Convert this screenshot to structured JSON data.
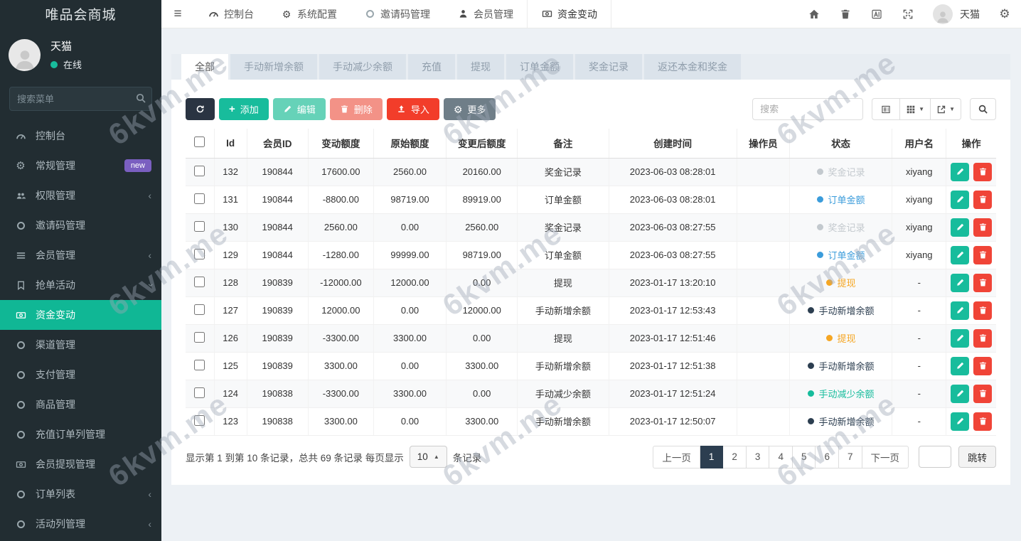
{
  "watermark": {
    "text": "6kvm.me"
  },
  "sidebar": {
    "title": "唯品会商城",
    "user": {
      "name": "天猫",
      "status": "在线"
    },
    "search_placeholder": "搜索菜单",
    "items": [
      {
        "label": "控制台",
        "icon": "dashboard-icon"
      },
      {
        "label": "常规管理",
        "icon": "gears-icon",
        "badge": "new"
      },
      {
        "label": "权限管理",
        "icon": "users-icon",
        "chevron": "left"
      },
      {
        "label": "邀请码管理",
        "icon": "circle-icon"
      },
      {
        "label": "会员管理",
        "icon": "list-icon",
        "chevron": "left"
      },
      {
        "label": "抢单活动",
        "icon": "bookmark-icon",
        "chevron": "down"
      },
      {
        "label": "资金变动",
        "icon": "money-icon",
        "active": true
      },
      {
        "label": "渠道管理",
        "icon": "circle-icon"
      },
      {
        "label": "支付管理",
        "icon": "circle-icon"
      },
      {
        "label": "商品管理",
        "icon": "circle-icon"
      },
      {
        "label": "充值订单列管理",
        "icon": "circle-icon"
      },
      {
        "label": "会员提现管理",
        "icon": "money-icon"
      },
      {
        "label": "订单列表",
        "icon": "circle-icon",
        "chevron": "left"
      },
      {
        "label": "活动列管理",
        "icon": "circle-icon",
        "chevron": "left"
      }
    ]
  },
  "navbar": {
    "items": [
      {
        "label": "控制台",
        "icon": "dashboard-icon"
      },
      {
        "label": "系统配置",
        "icon": "gear-icon"
      },
      {
        "label": "邀请码管理",
        "icon": "circle-icon"
      },
      {
        "label": "会员管理",
        "icon": "person-icon"
      },
      {
        "label": "资金变动",
        "icon": "money-icon",
        "active": true
      }
    ],
    "right_icons": [
      "home-icon",
      "trash-icon",
      "translate-icon",
      "fullscreen-icon"
    ],
    "user_name": "天猫"
  },
  "tabs": [
    "全部",
    "手动新增余额",
    "手动减少余额",
    "充值",
    "提现",
    "订单金额",
    "奖金记录",
    "返还本金和奖金"
  ],
  "active_tab": "全部",
  "toolbar": {
    "add_label": "添加",
    "edit_label": "编辑",
    "delete_label": "删除",
    "import_label": "导入",
    "more_label": "更多",
    "search_placeholder": "搜索"
  },
  "table": {
    "columns": [
      "Id",
      "会员ID",
      "变动额度",
      "原始额度",
      "变更后额度",
      "备注",
      "创建时间",
      "操作员",
      "状态",
      "用户名",
      "操作"
    ],
    "status_colors": {
      "gray": "#c3c9ce",
      "blue": "#3b9cdb",
      "orange": "#f5a623",
      "dark": "#2c3e50",
      "green": "#16bc9c"
    },
    "rows": [
      {
        "id": "132",
        "member_id": "190844",
        "change": "17600.00",
        "original": "2560.00",
        "after": "20160.00",
        "remark": "奖金记录",
        "created": "2023-06-03 08:28:01",
        "operator": "",
        "status": {
          "label": "奖金记录",
          "color": "gray"
        },
        "username": "xiyang"
      },
      {
        "id": "131",
        "member_id": "190844",
        "change": "-8800.00",
        "original": "98719.00",
        "after": "89919.00",
        "remark": "订单金额",
        "created": "2023-06-03 08:28:01",
        "operator": "",
        "status": {
          "label": "订单金额",
          "color": "blue"
        },
        "username": "xiyang"
      },
      {
        "id": "130",
        "member_id": "190844",
        "change": "2560.00",
        "original": "0.00",
        "after": "2560.00",
        "remark": "奖金记录",
        "created": "2023-06-03 08:27:55",
        "operator": "",
        "status": {
          "label": "奖金记录",
          "color": "gray"
        },
        "username": "xiyang"
      },
      {
        "id": "129",
        "member_id": "190844",
        "change": "-1280.00",
        "original": "99999.00",
        "after": "98719.00",
        "remark": "订单金额",
        "created": "2023-06-03 08:27:55",
        "operator": "",
        "status": {
          "label": "订单金额",
          "color": "blue"
        },
        "username": "xiyang"
      },
      {
        "id": "128",
        "member_id": "190839",
        "change": "-12000.00",
        "original": "12000.00",
        "after": "0.00",
        "remark": "提现",
        "created": "2023-01-17 13:20:10",
        "operator": "",
        "status": {
          "label": "提现",
          "color": "orange"
        },
        "username": "-"
      },
      {
        "id": "127",
        "member_id": "190839",
        "change": "12000.00",
        "original": "0.00",
        "after": "12000.00",
        "remark": "手动新增余额",
        "created": "2023-01-17 12:53:43",
        "operator": "",
        "status": {
          "label": "手动新增余额",
          "color": "dark"
        },
        "username": "-"
      },
      {
        "id": "126",
        "member_id": "190839",
        "change": "-3300.00",
        "original": "3300.00",
        "after": "0.00",
        "remark": "提现",
        "created": "2023-01-17 12:51:46",
        "operator": "",
        "status": {
          "label": "提现",
          "color": "orange"
        },
        "username": "-"
      },
      {
        "id": "125",
        "member_id": "190839",
        "change": "3300.00",
        "original": "0.00",
        "after": "3300.00",
        "remark": "手动新增余额",
        "created": "2023-01-17 12:51:38",
        "operator": "",
        "status": {
          "label": "手动新增余额",
          "color": "dark"
        },
        "username": "-"
      },
      {
        "id": "124",
        "member_id": "190838",
        "change": "-3300.00",
        "original": "3300.00",
        "after": "0.00",
        "remark": "手动减少余额",
        "created": "2023-01-17 12:51:24",
        "operator": "",
        "status": {
          "label": "手动减少余额",
          "color": "green"
        },
        "username": "-"
      },
      {
        "id": "123",
        "member_id": "190838",
        "change": "3300.00",
        "original": "0.00",
        "after": "3300.00",
        "remark": "手动新增余额",
        "created": "2023-01-17 12:50:07",
        "operator": "",
        "status": {
          "label": "手动新增余额",
          "color": "dark"
        },
        "username": "-"
      }
    ]
  },
  "footer": {
    "summary_prefix": "显示第 1 到第 10 条记录，总共 69 条记录 每页显示",
    "summary_suffix": "条记录",
    "per_page": "10",
    "prev_label": "上一页",
    "next_label": "下一页",
    "pages": [
      "1",
      "2",
      "3",
      "4",
      "5",
      "6",
      "7"
    ],
    "active_page": "1",
    "jump_label": "跳转"
  }
}
